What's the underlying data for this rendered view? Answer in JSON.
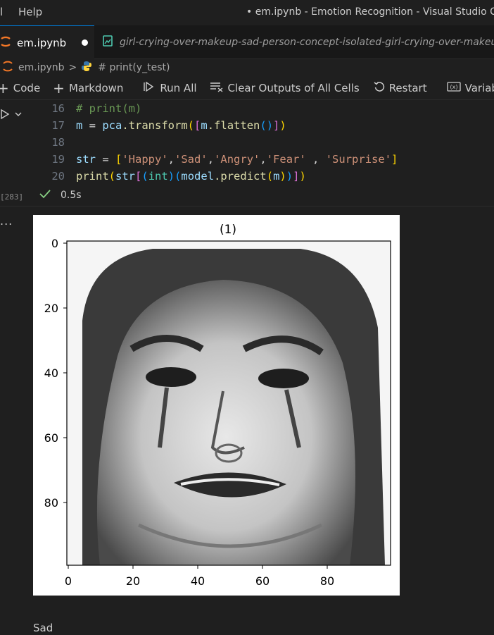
{
  "titlebar": {
    "menu_partial": "l",
    "help_label": "Help",
    "window_title": "• em.ipynb - Emotion Recognition - Visual Studio Code"
  },
  "tabs": [
    {
      "label": "em.ipynb",
      "state": "modified"
    },
    {
      "label": "girl-crying-over-makeup-sad-person-concept-isolated-girl-crying-over-makeup"
    }
  ],
  "breadcrumb": {
    "file": "em.ipynb",
    "separator": ">",
    "cell": "# print(y_test)"
  },
  "toolbar": {
    "code_label": "Code",
    "markdown_label": "Markdown",
    "run_all_label": "Run All",
    "clear_label": "Clear Outputs of All Cells",
    "restart_label": "Restart",
    "variables_label": "Variables"
  },
  "cell": {
    "execution_count": "[283]",
    "status_time": "0.5s",
    "lines": [
      {
        "num": "16"
      },
      {
        "num": "17"
      },
      {
        "num": "18"
      },
      {
        "num": "19"
      },
      {
        "num": "20"
      }
    ],
    "code_text": {
      "l16_comment": "# print(m)",
      "l17_var": "m",
      "l17_eq": " = ",
      "l17_obj": "pca",
      "l17_method": ".transform",
      "l17_m": "m",
      "l17_flatten": ".flatten",
      "l19_var": "str",
      "l19_eq": " = ",
      "l19_s1": "'Happy'",
      "l19_s2": "'Sad'",
      "l19_s3": "'Angry'",
      "l19_s4": "'Fear'",
      "l19_s5": "'Surprise'",
      "l20_print": "print",
      "l20_str": "str",
      "l20_int": "int",
      "l20_model": "model",
      "l20_predict": ".predict",
      "l20_m": "m"
    }
  },
  "output": {
    "more_label": "...",
    "figure": {
      "title": "(1)",
      "x_ticks": [
        "0",
        "20",
        "40",
        "60",
        "80"
      ],
      "y_ticks": [
        "0",
        "20",
        "40",
        "60",
        "80"
      ]
    },
    "printed_text": "Sad"
  },
  "colors": {
    "accent": "#0078d4",
    "modified_dot": "#ffffff",
    "jupyter_icon": "#f37726",
    "success_check": "#89d185"
  }
}
